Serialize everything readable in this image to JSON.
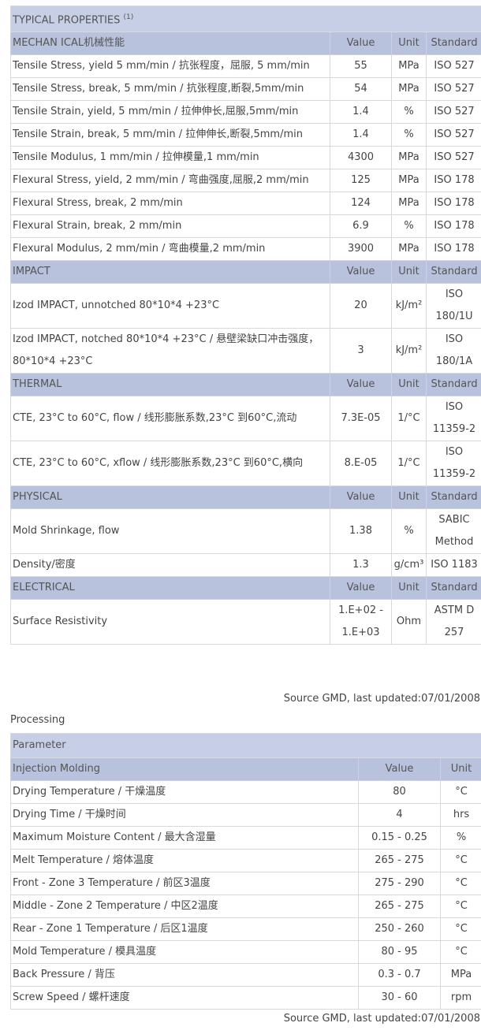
{
  "properties": {
    "title": "TYPICAL PROPERTIES",
    "title_note": "(1)",
    "sections": [
      {
        "name": "MECHAN ICAL机械性能",
        "value_header": "Value",
        "unit_header": "Unit",
        "standard_header": "Standard",
        "rows": [
          {
            "property": "Tensile Stress, yield 5 mm/min / 抗张程度，屈服, 5 mm/min",
            "value": "55",
            "unit": "MPa",
            "standard": "ISO 527"
          },
          {
            "property": "Tensile Stress, break, 5 mm/min / 抗张程度,断裂,5mm/min",
            "value": "54",
            "unit": "MPa",
            "standard": "ISO 527"
          },
          {
            "property": "Tensile Strain, yield, 5 mm/min / 拉伸伸长,屈服,5mm/min",
            "value": "1.4",
            "unit": "%",
            "standard": "ISO 527"
          },
          {
            "property": "Tensile Strain, break, 5 mm/min / 拉伸伸长,断裂,5mm/min",
            "value": "1.4",
            "unit": "%",
            "standard": "ISO 527"
          },
          {
            "property": "Tensile Modulus, 1 mm/min / 拉伸模量,1 mm/min",
            "value": "4300",
            "unit": "MPa",
            "standard": "ISO 527"
          },
          {
            "property": "Flexural Stress, yield, 2 mm/min / 弯曲强度,屈服,2 mm/min",
            "value": "125",
            "unit": "MPa",
            "standard": "ISO 178"
          },
          {
            "property": "Flexural Stress, break, 2 mm/min",
            "value": "124",
            "unit": "MPa",
            "standard": "ISO 178"
          },
          {
            "property": "Flexural Strain, break, 2 mm/min",
            "value": "6.9",
            "unit": "%",
            "standard": "ISO 178"
          },
          {
            "property": "Flexural Modulus, 2 mm/min / 弯曲模量,2 mm/min",
            "value": "3900",
            "unit": "MPa",
            "standard": "ISO 178"
          }
        ]
      },
      {
        "name": "IMPACT",
        "value_header": "Value",
        "unit_header": "Unit",
        "standard_header": "Standard",
        "rows": [
          {
            "property": "Izod IMPACT, unnotched 80*10*4 +23°C",
            "value": "20",
            "unit": "kJ/m²",
            "standard": "ISO 180/1U"
          },
          {
            "property": "Izod IMPACT, notched 80*10*4 +23°C / 悬壁梁缺口冲击强度，80*10*4 +23°C",
            "value": "3",
            "unit": "kJ/m²",
            "standard": "ISO 180/1A"
          }
        ]
      },
      {
        "name": "THERMAL",
        "value_header": "Value",
        "unit_header": "Unit",
        "standard_header": "Standard",
        "rows": [
          {
            "property": "CTE, 23°C to 60°C, flow / 线形膨胀系数,23°C 到60°C,流动",
            "value": "7.3E-05",
            "unit": "1/°C",
            "standard": "ISO 11359-2"
          },
          {
            "property": "CTE, 23°C to 60°C, xflow / 线形膨胀系数,23°C 到60°C,横向",
            "value": "8.E-05",
            "unit": "1/°C",
            "standard": "ISO 11359-2"
          }
        ]
      },
      {
        "name": "PHYSICAL",
        "value_header": "Value",
        "unit_header": "Unit",
        "standard_header": "Standard",
        "rows": [
          {
            "property": "Mold Shrinkage, flow",
            "value": "1.38",
            "unit": "%",
            "standard": "SABIC Method"
          },
          {
            "property": "Density/密度",
            "value": "1.3",
            "unit": "g/cm³",
            "standard": "ISO 1183"
          }
        ]
      },
      {
        "name": "ELECTRICAL",
        "value_header": "Value",
        "unit_header": "Unit",
        "standard_header": "Standard",
        "rows": [
          {
            "property": "Surface Resistivity",
            "value": "1.E+02 - 1.E+03",
            "unit": "Ohm",
            "standard": "ASTM D 257"
          }
        ]
      }
    ],
    "source": "Source GMD, last updated:07/01/2008"
  },
  "processing": {
    "label": "Processing",
    "parameter_header": "Parameter",
    "section_name": "Injection Molding",
    "value_header": "Value",
    "unit_header": "Unit",
    "rows": [
      {
        "parameter": "Drying Temperature / 干燥温度",
        "value": "80",
        "unit": "°C"
      },
      {
        "parameter": "Drying Time / 干燥时间",
        "value": "4",
        "unit": "hrs"
      },
      {
        "parameter": "Maximum Moisture Content / 最大含湿量",
        "value": "0.15 - 0.25",
        "unit": "%"
      },
      {
        "parameter": "Melt Temperature / 熔体温度",
        "value": "265 - 275",
        "unit": "°C"
      },
      {
        "parameter": "Front - Zone 3 Temperature / 前区3温度",
        "value": "275 - 290",
        "unit": "°C"
      },
      {
        "parameter": "Middle - Zone 2 Temperature / 中区2温度",
        "value": "265 - 275",
        "unit": "°C"
      },
      {
        "parameter": "Rear - Zone 1 Temperature / 后区1温度",
        "value": "250 - 260",
        "unit": "°C"
      },
      {
        "parameter": "Mold Temperature / 模具温度",
        "value": "80 - 95",
        "unit": "°C"
      },
      {
        "parameter": "Back Pressure / 背压",
        "value": "0.3 - 0.7",
        "unit": "MPa"
      },
      {
        "parameter": "Screw Speed / 螺杆速度",
        "value": "30 - 60",
        "unit": "rpm"
      }
    ],
    "source": "Source GMD, last updated:07/01/2008"
  }
}
